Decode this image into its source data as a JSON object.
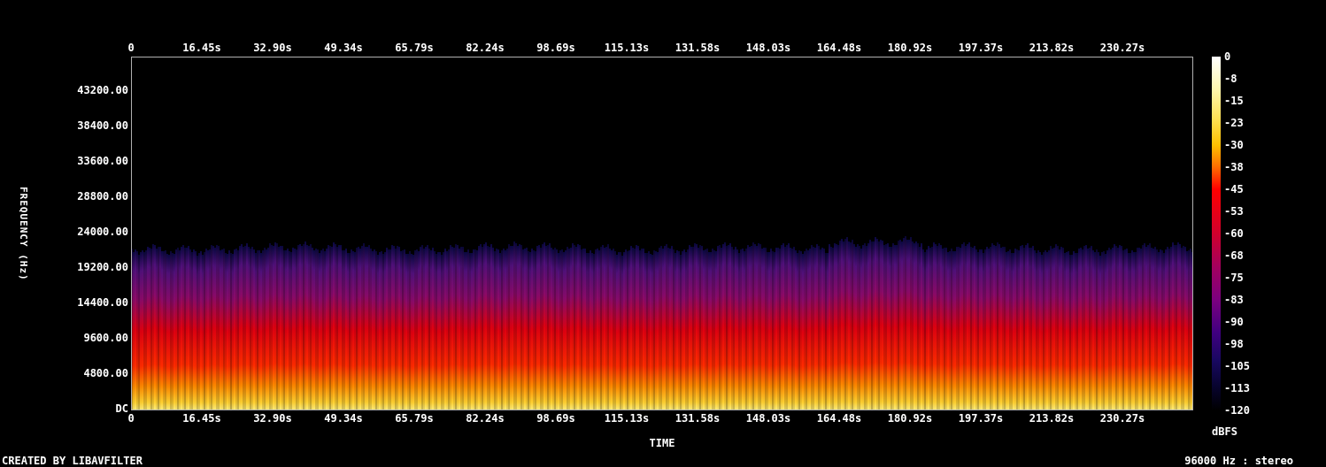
{
  "spectrogram": {
    "time_axis_top": {
      "ticks": [
        "0",
        "16.45s",
        "32.90s",
        "49.34s",
        "65.79s",
        "82.24s",
        "98.69s",
        "115.13s",
        "131.58s",
        "148.03s",
        "164.48s",
        "180.92s",
        "197.37s",
        "213.82s",
        "230.27s"
      ]
    },
    "frequency_axis": {
      "title": "FREQUENCY (Hz)",
      "ticks": [
        "43200.00",
        "38400.00",
        "33600.00",
        "28800.00",
        "24000.00",
        "19200.00",
        "14400.00",
        "9600.00",
        "4800.00",
        "DC"
      ]
    },
    "time_axis_bottom": {
      "ticks": [
        "0",
        "16.45s",
        "32.90s",
        "49.34s",
        "65.79s",
        "82.24s",
        "98.69s",
        "115.13s",
        "131.58s",
        "148.03s",
        "164.48s",
        "180.92s",
        "197.37s",
        "213.82s",
        "230.27s"
      ],
      "title": "TIME"
    },
    "color_scale": {
      "ticks": [
        "0",
        "-8",
        "-15",
        "-23",
        "-30",
        "-38",
        "-45",
        "-53",
        "-60",
        "-68",
        "-75",
        "-83",
        "-90",
        "-98",
        "-105",
        "-113",
        "-120"
      ],
      "unit": "dBFS"
    }
  },
  "footer": {
    "credit": "CREATED BY LIBAVFILTER",
    "stream_info": "96000 Hz : stereo"
  }
}
